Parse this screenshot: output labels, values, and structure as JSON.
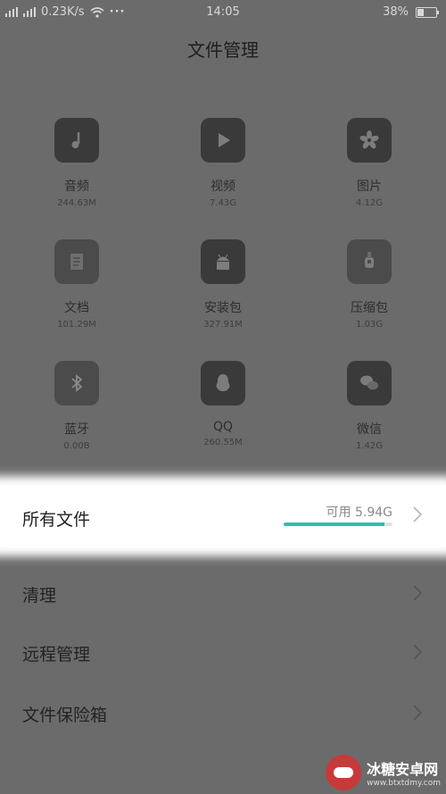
{
  "status_bar": {
    "network_speed": "0.23K/s",
    "time": "14:05",
    "battery": "38%",
    "battery_level": 0.38
  },
  "page_title": "文件管理",
  "categories": [
    {
      "label": "音频",
      "size": "244.63M",
      "icon": "music-note-icon"
    },
    {
      "label": "视频",
      "size": "7.43G",
      "icon": "play-icon"
    },
    {
      "label": "图片",
      "size": "4.12G",
      "icon": "flower-icon"
    },
    {
      "label": "文档",
      "size": "101.29M",
      "icon": "document-icon"
    },
    {
      "label": "安装包",
      "size": "327.91M",
      "icon": "android-icon"
    },
    {
      "label": "压缩包",
      "size": "1.03G",
      "icon": "zip-icon"
    },
    {
      "label": "蓝牙",
      "size": "0.00B",
      "icon": "bluetooth-icon"
    },
    {
      "label": "QQ",
      "size": "260.55M",
      "icon": "qq-icon"
    },
    {
      "label": "微信",
      "size": "1.42G",
      "icon": "wechat-icon"
    }
  ],
  "all_files": {
    "label": "所有文件",
    "free_space": "可用 5.94G",
    "used_fraction": 0.93
  },
  "menu": [
    {
      "label": "清理"
    },
    {
      "label": "远程管理"
    },
    {
      "label": "文件保险箱"
    }
  ],
  "watermark": {
    "name": "冰糖安卓网",
    "url": "www.btxtdmy.com"
  }
}
